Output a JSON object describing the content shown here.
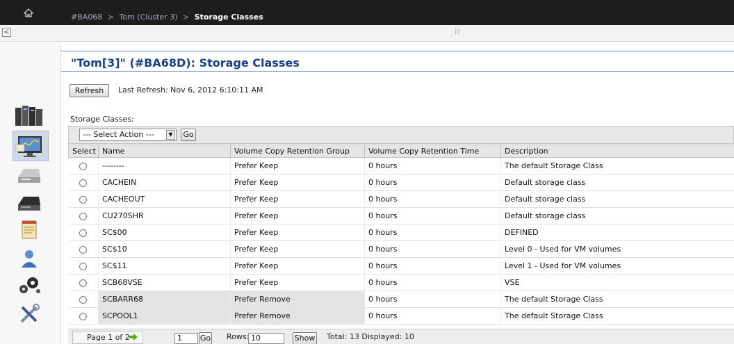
{
  "breadcrumb": {
    "item1": "#BA068",
    "item2": "Tom (Cluster 3)",
    "current": "Storage Classes",
    "separator": ">"
  },
  "page": {
    "title": "\"Tom[3]\" (#BA68D): Storage Classes"
  },
  "refresh": {
    "button_label": "Refresh",
    "last_refresh": "Last Refresh:  Nov 6, 2012 6:10:11 AM"
  },
  "section_label": "Storage Classes:",
  "toolbar": {
    "select_action": "--- Select Action ---",
    "go_label": "Go"
  },
  "columns": [
    "Select",
    "Name",
    "Volume Copy Retention Group",
    "Volume Copy Retention Time",
    "Description"
  ],
  "rows": [
    {
      "name": "--------",
      "group": "Prefer Keep",
      "time": "0 hours",
      "description": "The default Storage Class"
    },
    {
      "name": "CACHEIN",
      "group": "Prefer Keep",
      "time": "0 hours",
      "description": "Default storage class"
    },
    {
      "name": "CACHEOUT",
      "group": "Prefer Keep",
      "time": "0 hours",
      "description": "Default storage class"
    },
    {
      "name": "CU270SHR",
      "group": "Prefer Keep",
      "time": "0 hours",
      "description": "Default storage class"
    },
    {
      "name": "SC$00",
      "group": "Prefer Keep",
      "time": "0 hours",
      "description": "DEFINED"
    },
    {
      "name": "SC$10",
      "group": "Prefer Keep",
      "time": "0 hours",
      "description": "Level 0 - Used for VM volumes"
    },
    {
      "name": "SC$11",
      "group": "Prefer Keep",
      "time": "0 hours",
      "description": "Level 1 - Used for VM volumes"
    },
    {
      "name": "SCB68VSE",
      "group": "Prefer Keep",
      "time": "0 hours",
      "description": "VSE"
    },
    {
      "name": "SCBARR68",
      "group": "Prefer Remove",
      "time": "0 hours",
      "description": "The default Storage Class"
    },
    {
      "name": "SCPOOL1",
      "group": "Prefer Remove",
      "time": "0 hours",
      "description": "The default Storage Class"
    }
  ],
  "pager": {
    "page_of": "Page 1 of 2",
    "page_value": "1",
    "go_label": "Go",
    "rows_label": "Rows:",
    "rows_value": "10",
    "show_label": "Show",
    "totals": "Total: 13   Displayed: 10"
  },
  "icons": [
    "home-icon",
    "scroll-left-icon",
    "servers-icon",
    "monitor-icon",
    "virtual-drive-icon",
    "physical-drive-icon",
    "notepad-icon",
    "user-icon",
    "gears-icon",
    "tools-icon",
    "next-page-icon",
    "dropdown-arrow-icon"
  ],
  "colors": {
    "topbar": "#1d1d1d",
    "title": "#1a3f8c",
    "title_rule": "#5e8bd0",
    "next_arrow": "#4fae1c"
  }
}
